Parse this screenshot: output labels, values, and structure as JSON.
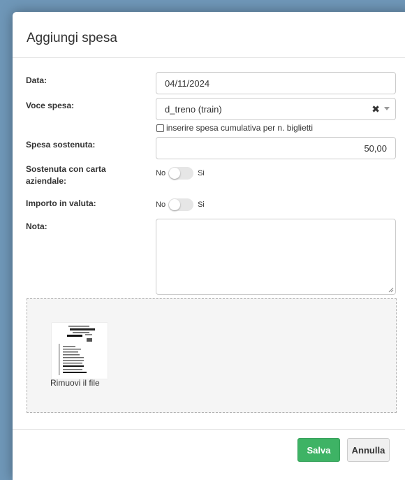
{
  "modal": {
    "title": "Aggiungi spesa"
  },
  "form": {
    "date": {
      "label": "Data:",
      "value": "04/11/2024"
    },
    "expense_item": {
      "label": "Voce spesa:",
      "value": "d_treno (train)",
      "clear_icon": "times-icon",
      "arrow_icon": "caret-down-icon"
    },
    "cumulative": {
      "label": "inserire spesa cumulativa per n. biglietti",
      "checked": false
    },
    "amount": {
      "label": "Spesa sostenuta:",
      "value": "50,00"
    },
    "company_card": {
      "label": "Sostenuta con carta aziendale:",
      "off_label": "No",
      "on_label": "Si",
      "value": false
    },
    "foreign_currency": {
      "label": "Importo in valuta:",
      "off_label": "No",
      "on_label": "Si",
      "value": false
    },
    "note": {
      "label": "Nota:",
      "value": ""
    }
  },
  "attachment": {
    "remove_label": "Rimuovi il file"
  },
  "footer": {
    "save_label": "Salva",
    "cancel_label": "Annulla",
    "save_color": "#3eb365"
  }
}
